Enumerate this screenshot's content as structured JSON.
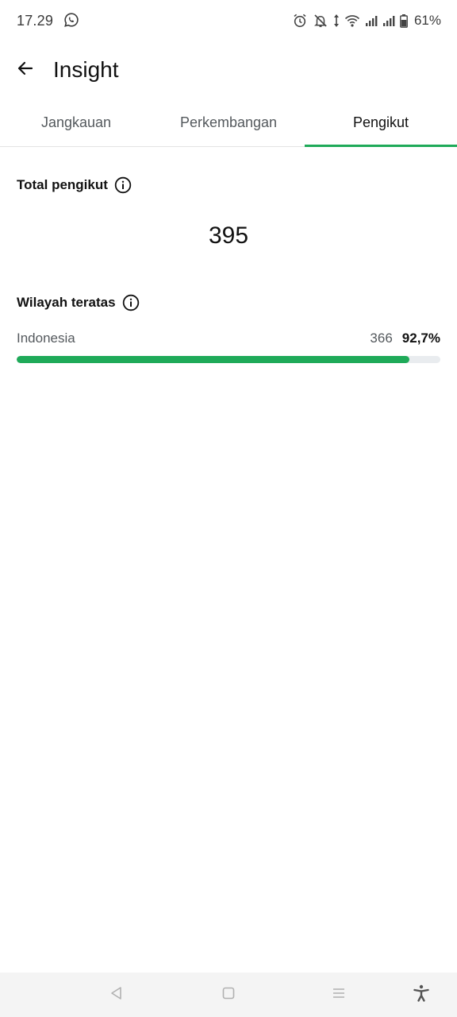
{
  "status_bar": {
    "time": "17.29",
    "battery_percent": "61%",
    "icons": [
      "whatsapp-icon",
      "alarm-icon",
      "notifications-off-icon",
      "data-arrows-icon",
      "wifi-icon",
      "signal-icon",
      "signal-icon",
      "battery-icon"
    ]
  },
  "app_bar": {
    "title": "Insight",
    "back_icon": "arrow-back-icon"
  },
  "tabs": [
    {
      "label": "Jangkauan",
      "active": false
    },
    {
      "label": "Perkembangan",
      "active": false
    },
    {
      "label": "Pengikut",
      "active": true
    }
  ],
  "followers": {
    "total_label": "Total pengikut",
    "total_value": "395"
  },
  "regions": {
    "label": "Wilayah teratas",
    "items": [
      {
        "name": "Indonesia",
        "count": "366",
        "percent": "92,7%",
        "fraction": 0.927
      }
    ]
  },
  "nav_bar": {
    "icons": [
      "back-triangle-icon",
      "home-square-icon",
      "recents-menu-icon",
      "accessibility-icon"
    ]
  },
  "colors": {
    "accent": "#1faa59",
    "track": "#e9ecef",
    "text_secondary": "#54595d"
  }
}
